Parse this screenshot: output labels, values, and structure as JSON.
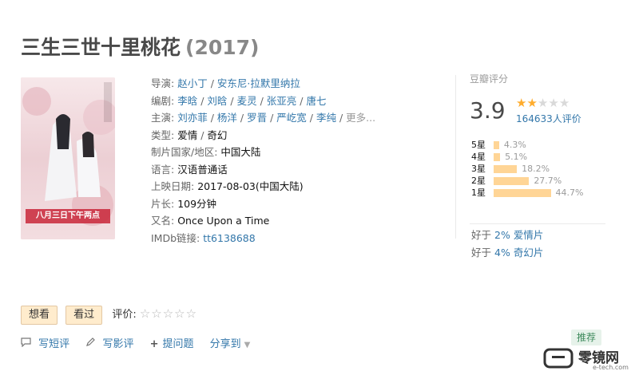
{
  "movie": {
    "title": "三生三世十里桃花",
    "year": "(2017)"
  },
  "poster": {
    "text": "八月三日下午两点"
  },
  "info": {
    "director_label": "导演:",
    "directors": [
      "赵小丁",
      "安东尼·拉默里纳拉"
    ],
    "writer_label": "编剧:",
    "writers": [
      "李晗",
      "刘晗",
      "麦灵",
      "张亚亮",
      "唐七"
    ],
    "cast_label": "主演:",
    "cast": [
      "刘亦菲",
      "杨洋",
      "罗晋",
      "严屹宽",
      "李纯"
    ],
    "more": "更多...",
    "genre_label": "类型:",
    "genres": [
      "爱情",
      "奇幻"
    ],
    "country_label": "制片国家/地区:",
    "country": "中国大陆",
    "language_label": "语言:",
    "language": "汉语普通话",
    "release_label": "上映日期:",
    "release": "2017-08-03(中国大陆)",
    "runtime_label": "片长:",
    "runtime": "109分钟",
    "aka_label": "又名:",
    "aka": "Once Upon a Time",
    "imdb_label": "IMDb链接:",
    "imdb": "tt6138688"
  },
  "rating": {
    "label": "豆瓣评分",
    "score": "3.9",
    "stars_filled": 2,
    "stars_total": 5,
    "votes": "164633人评价",
    "distribution": [
      {
        "label": "5星",
        "percent": 4.3,
        "text": "4.3%"
      },
      {
        "label": "4星",
        "percent": 5.1,
        "text": "5.1%"
      },
      {
        "label": "3星",
        "percent": 18.2,
        "text": "18.2%"
      },
      {
        "label": "2星",
        "percent": 27.7,
        "text": "27.7%"
      },
      {
        "label": "1星",
        "percent": 44.7,
        "text": "44.7%"
      }
    ],
    "better_than": [
      {
        "prefix": "好于",
        "percent": "2%",
        "category": "爱情片"
      },
      {
        "prefix": "好于",
        "percent": "4%",
        "category": "奇幻片"
      }
    ]
  },
  "actions": {
    "want": "想看",
    "seen": "看过",
    "rate_label": "评价:",
    "rate_stars": "☆☆☆☆☆"
  },
  "tools": {
    "short_review": "写短评",
    "review": "写影评",
    "ask": "提问题",
    "share": "分享到",
    "recommend": "推荐"
  },
  "logo": {
    "name": "零镜网",
    "site": "e-tech.com"
  },
  "colors": {
    "link": "#3377aa",
    "star": "#ffac2d",
    "bar": "#ffd596"
  }
}
